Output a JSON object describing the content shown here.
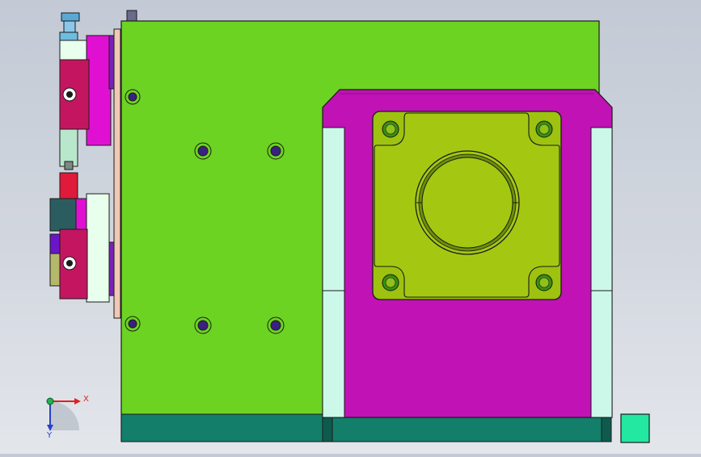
{
  "view": {
    "type": "CAD assembly viewport (front view)",
    "background": "#cfd5de"
  },
  "triad": {
    "x_label": "X",
    "y_label": "Y",
    "x_color": "#e02020",
    "y_color": "#2a3fc8",
    "origin_color": "#22b14c"
  },
  "colors": {
    "base_plate": "#6cd322",
    "motor_mount": "#c012b5",
    "motor_flange": "#9dc20f",
    "flange_hole": "#3a8f10",
    "side_rail": "#ccf8ea",
    "base_strip": "#137e6a",
    "bracket": "#e010d2",
    "clamp_block": "#c41560",
    "clamp_block_light": "#e8ffee",
    "slot_strip": "#7a22b8",
    "screw": "#3a2080",
    "steel_blue": "#5aa8d4",
    "dark_teal": "#2b5d60",
    "olive": "#b4b86a",
    "red": "#e01a3a",
    "green_cube": "#22e8a2",
    "outline": "#1b1b1b"
  }
}
